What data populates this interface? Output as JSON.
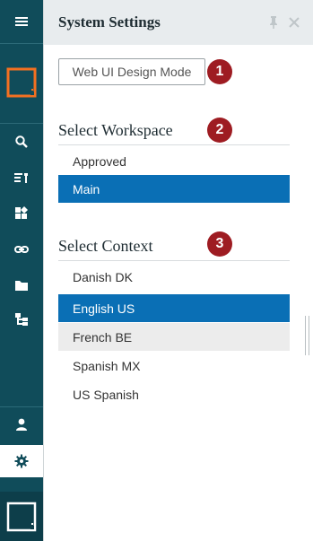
{
  "rail": {
    "items": [
      {
        "name": "menu-icon"
      },
      {
        "name": "app-logo-icon"
      },
      {
        "name": "search-icon"
      },
      {
        "name": "list-wrench-icon"
      },
      {
        "name": "widgets-icon"
      },
      {
        "name": "link-icon"
      },
      {
        "name": "folder-icon"
      },
      {
        "name": "hierarchy-icon"
      },
      {
        "name": "user-icon"
      },
      {
        "name": "gear-icon",
        "active": true
      },
      {
        "name": "app-logo-icon"
      }
    ],
    "colors": {
      "background": "#104c5a",
      "accent": "#f37021"
    }
  },
  "panel": {
    "title": "System Settings",
    "pin_icon": "pin-icon",
    "close_icon": "close-icon",
    "design_mode_button": "Web UI Design Mode",
    "badges": [
      "1",
      "2",
      "3"
    ],
    "badge_color": "#9e1c22",
    "selection_color": "#0a6fb5"
  },
  "workspace": {
    "title": "Select Workspace",
    "items": [
      "Approved",
      "Main"
    ],
    "selected": "Main"
  },
  "context": {
    "title": "Select Context",
    "items": [
      "Danish DK",
      "English US",
      "French BE",
      "Spanish MX",
      "US Spanish"
    ],
    "selected": "English US",
    "hovered": "French BE"
  }
}
